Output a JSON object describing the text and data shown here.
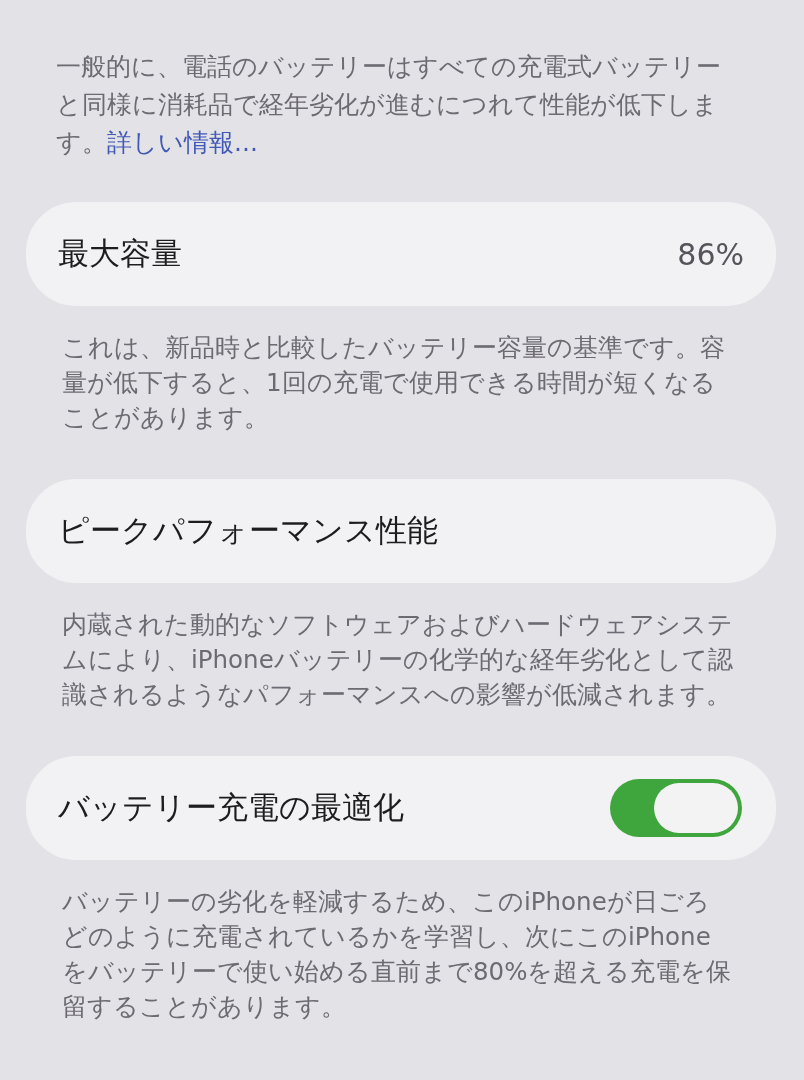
{
  "intro": {
    "text": "一般的に、電話のバッテリーはすべての充電式バッテリーと同様に消耗品で経年劣化が進むにつれて性能が低下します。",
    "link": "詳しい情報..."
  },
  "sections": [
    {
      "kind": "value",
      "title": "最大容量",
      "value": "86%",
      "footer": "これは、新品時と比較したバッテリー容量の基準です。容量が低下すると、1回の充電で使用できる時間が短くなることがあります。"
    },
    {
      "kind": "plain",
      "title": "ピークパフォーマンス性能",
      "footer": "内蔵された動的なソフトウェアおよびハードウェアシステムにより、iPhoneバッテリーの化学的な経年劣化として認識されるようなパフォーマンスへの影響が低減されます。"
    },
    {
      "kind": "toggle",
      "title": "バッテリー充電の最適化",
      "on": true,
      "footer": "バッテリーの劣化を軽減するため、このiPhoneが日ごろどのように充電されているかを学習し、次にこのiPhoneをバッテリーで使い始める直前まで80%を超える充電を保留することがあります。"
    }
  ]
}
